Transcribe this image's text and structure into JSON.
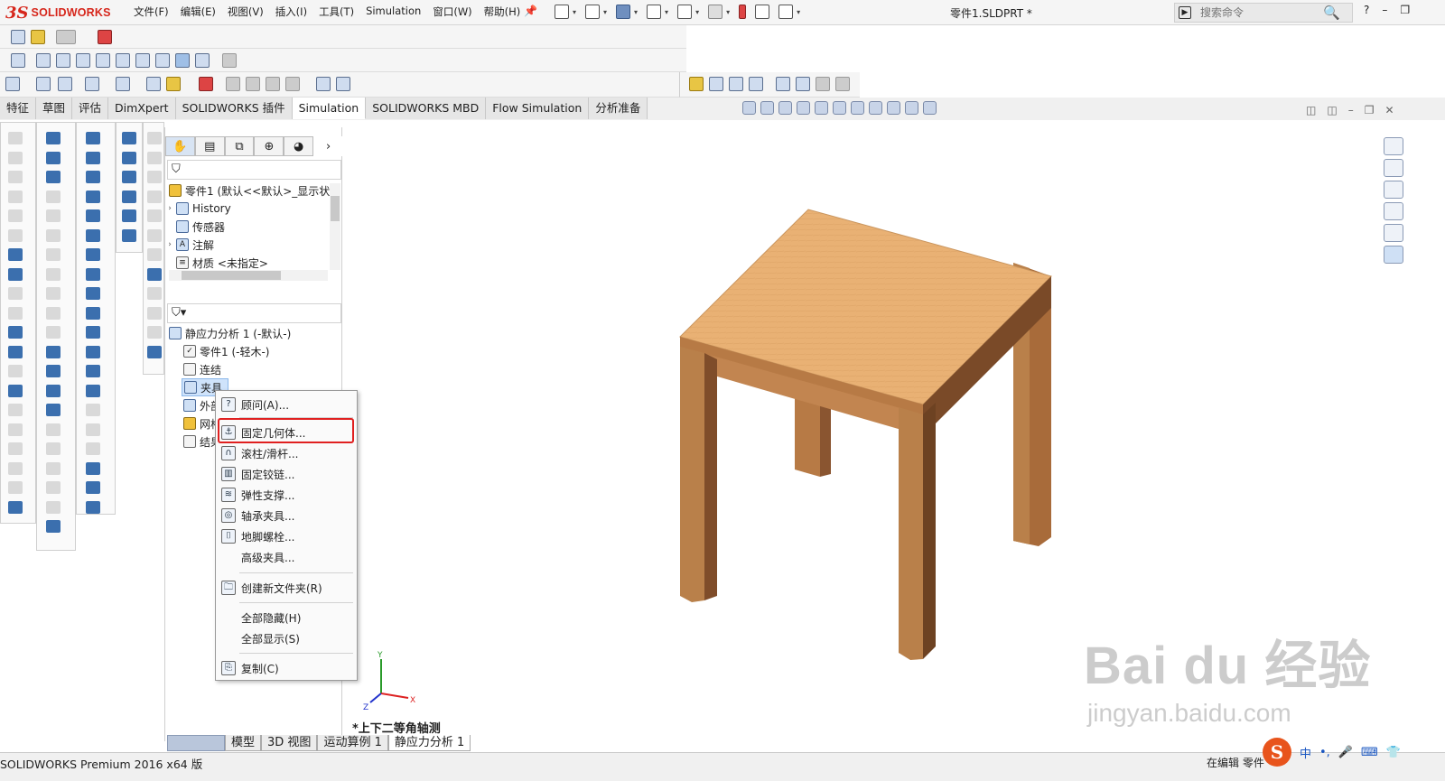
{
  "app": {
    "brand_prefix": "3S",
    "brand_name": "SOLIDWORKS",
    "doc_title": "零件1.SLDPRT *"
  },
  "menu": [
    "文件(F)",
    "编辑(E)",
    "视图(V)",
    "插入(I)",
    "工具(T)",
    "Simulation",
    "窗口(W)",
    "帮助(H)"
  ],
  "search": {
    "placeholder": "搜索命令"
  },
  "tabs": [
    "特征",
    "草图",
    "评估",
    "DimXpert",
    "SOLIDWORKS 插件",
    "Simulation",
    "SOLIDWORKS MBD",
    "Flow Simulation",
    "分析准备"
  ],
  "active_tab": "Simulation",
  "feature_tree": {
    "root": "零件1 (默认<<默认>_显示状",
    "items": [
      "History",
      "传感器",
      "注解",
      "材质 <未指定>"
    ]
  },
  "sim_tree": {
    "root": "静应力分析 1 (-默认-)",
    "items": [
      "零件1 (-轻木-)",
      "连结",
      "夹具",
      "外部",
      "网格",
      "结果"
    ]
  },
  "context_menu": {
    "items": [
      {
        "label": "顾问(A)...",
        "icon": "advisor-icon"
      },
      {
        "label": "固定几何体...",
        "icon": "fixed-geometry-icon",
        "highlighted": true
      },
      {
        "label": "滚柱/滑杆...",
        "icon": "roller-slider-icon"
      },
      {
        "label": "固定铰链...",
        "icon": "fixed-hinge-icon"
      },
      {
        "label": "弹性支撑...",
        "icon": "elastic-support-icon"
      },
      {
        "label": "轴承夹具...",
        "icon": "bearing-fixture-icon"
      },
      {
        "label": "地脚螺栓...",
        "icon": "foundation-bolt-icon"
      },
      {
        "label": "高级夹具...",
        "icon": ""
      }
    ],
    "items2": [
      {
        "label": "创建新文件夹(R)",
        "icon": "folder-icon"
      }
    ],
    "items3": [
      {
        "label": "全部隐藏(H)"
      },
      {
        "label": "全部显示(S)"
      }
    ],
    "items4": [
      {
        "label": "复制(C)",
        "icon": "copy-icon"
      }
    ]
  },
  "view": {
    "orientation": "*上下二等角轴测",
    "triad": {
      "y": "Y",
      "x": "X",
      "z": "Z"
    }
  },
  "bottom_tabs": [
    "模型",
    "3D 视图",
    "运动算例 1",
    "静应力分析 1"
  ],
  "status": {
    "left": "SOLIDWORKS Premium 2016 x64 版",
    "right": "在编辑 零件"
  },
  "ime": {
    "logo": "S",
    "mode": "中"
  },
  "watermark": {
    "line1": "Bai du 经验",
    "line2": "jingyan.baidu.com"
  },
  "colors": {
    "accent": "#d6261b",
    "highlight_box": "#e02020",
    "wood_top": "#e9b174",
    "wood_side": "#b77a45"
  }
}
